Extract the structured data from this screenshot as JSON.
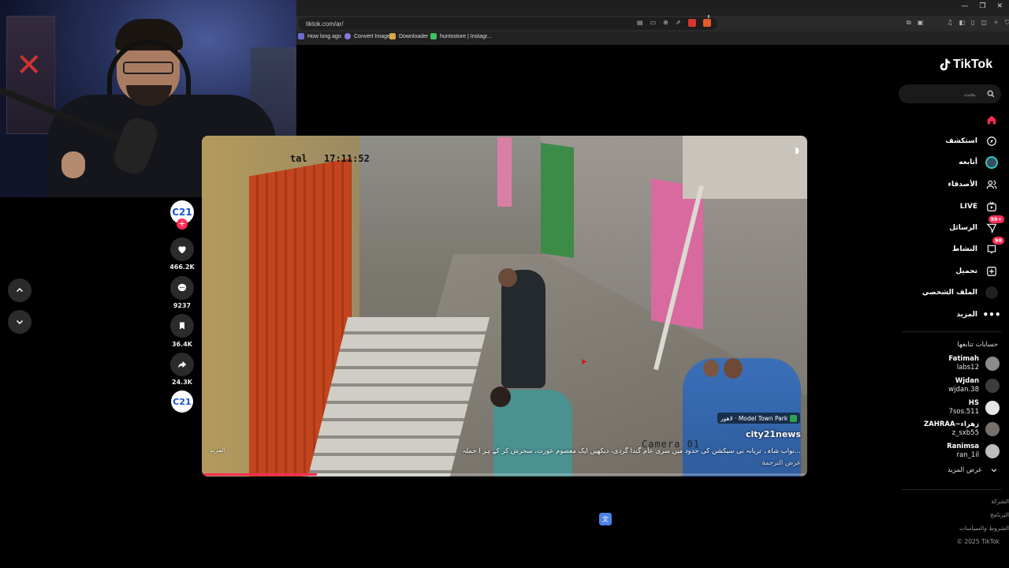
{
  "browser": {
    "url": "tiktok.com/ar/",
    "bookmarks": [
      {
        "label": "How long ago",
        "color": "#6b6bd6"
      },
      {
        "label": "Convert Image",
        "color": "#8a7ad8"
      },
      {
        "label": "Downloader",
        "color": "#d8a84a"
      },
      {
        "label": "huntostore | Instagr...",
        "color": "#3ec45e"
      }
    ],
    "url_badge": "6"
  },
  "player": {
    "likes": "466.2K",
    "comments": "9237",
    "saves": "36.4K",
    "shares": "24.3K",
    "avatar_text": "C21"
  },
  "video": {
    "timestamp": "17:11:52",
    "timestamp_prefix": "tal",
    "camera_label": "Camera 01",
    "more_label": "المزيد",
    "location": "لاهور · Model Town Park",
    "author": "city21news",
    "caption": "نواب شاہ۔ تربانہ نی سیکشن کی حدود میں سری عام گندا گردی، دیکھیں ایک معصوم عورت، سحرش کر کے ہر ا حملہ...",
    "translate_label": "عرض الترجمة",
    "progress": 0.19
  },
  "sidebar": {
    "logo": "TikTok",
    "search_placeholder": "بحث",
    "nav": [
      {
        "label": "",
        "icon": "home-icon",
        "color": "#fe2c55"
      },
      {
        "label": "استكشف",
        "icon": "compass-icon"
      },
      {
        "label": "أتابعه",
        "icon": "following-avatar-icon"
      },
      {
        "label": "الأصدقاء",
        "icon": "friends-icon"
      },
      {
        "label": "LIVE",
        "icon": "live-icon"
      },
      {
        "label": "الرسائل",
        "icon": "messages-icon",
        "badge": "99+"
      },
      {
        "label": "النشاط",
        "icon": "activity-icon",
        "badge": "98"
      },
      {
        "label": "تحميل",
        "icon": "upload-icon"
      },
      {
        "label": "الملف الشخصي",
        "icon": "profile-icon"
      },
      {
        "label": "المزيد",
        "icon": "more-icon"
      }
    ],
    "following_title": "حسابات تتابعها",
    "accounts": [
      {
        "name": "Fatimah",
        "user": "labs12"
      },
      {
        "name": "Wjdan",
        "user": "wjdan.38"
      },
      {
        "name": "HS",
        "user": "7sos.511"
      },
      {
        "name": "ZAHRAA~زهراء",
        "user": "z_sxb55"
      },
      {
        "name": "Ranimsa",
        "user": "ran_1il"
      }
    ],
    "see_more": "عرض المزيد",
    "footer": [
      "الشركة",
      "البرنامج",
      "الشروط والسياسات",
      "© 2025 TikTok"
    ]
  }
}
